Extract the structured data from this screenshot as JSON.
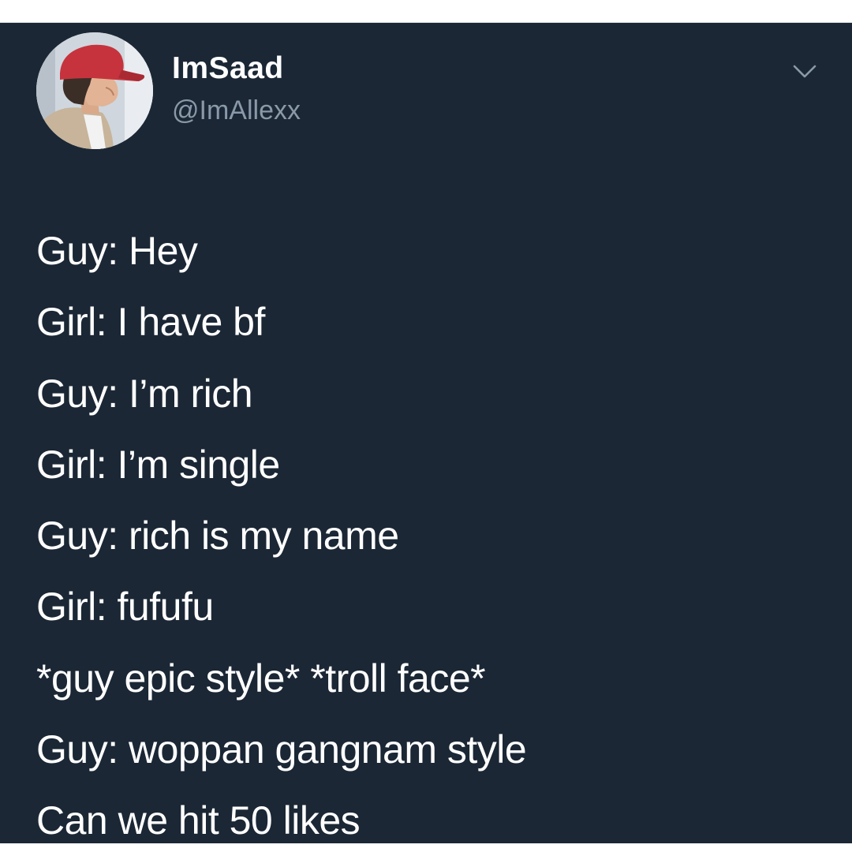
{
  "tweet": {
    "author": {
      "display_name": "ImSaad",
      "handle": "@ImAllexx",
      "avatar_icon": "profile-photo"
    },
    "menu_icon": "chevron-down-icon",
    "lines": [
      "Guy: Hey",
      "Girl: I have bf",
      "Guy: I’m rich",
      "Girl: I’m single",
      "Guy: rich is my name",
      "Girl: fufufu",
      "*guy epic style* *troll face*",
      "Guy: woppan gangnam style",
      "Can we hit 50 likes"
    ]
  },
  "colors": {
    "card_background": "#1b2735",
    "text_primary": "#ffffff",
    "text_secondary": "#8a99a8",
    "frame": "#ffffff"
  }
}
